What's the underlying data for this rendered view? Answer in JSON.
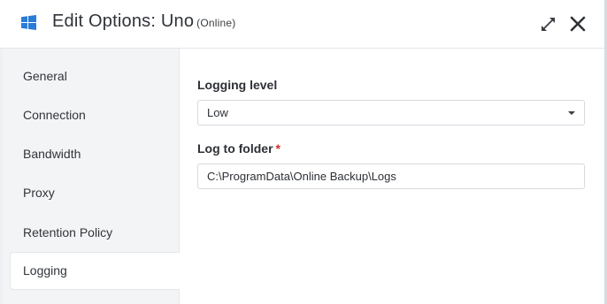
{
  "window": {
    "title": "Edit Options: Uno",
    "status": "(Online)",
    "icons": {
      "app": "windows-logo-icon",
      "expand": "expand-arrows-icon",
      "close": "close-x-icon"
    },
    "accent_color": "#2b7bd8"
  },
  "sidebar": {
    "items": [
      {
        "label": "General",
        "active": false
      },
      {
        "label": "Connection",
        "active": false
      },
      {
        "label": "Bandwidth",
        "active": false
      },
      {
        "label": "Proxy",
        "active": false
      },
      {
        "label": "Retention Policy",
        "active": false
      },
      {
        "label": "Logging",
        "active": true
      }
    ]
  },
  "main": {
    "logging_level": {
      "label": "Logging level",
      "value": "Low"
    },
    "log_folder": {
      "label": "Log to folder",
      "required_mark": "*",
      "value": "C:\\ProgramData\\Online Backup\\Logs"
    }
  }
}
